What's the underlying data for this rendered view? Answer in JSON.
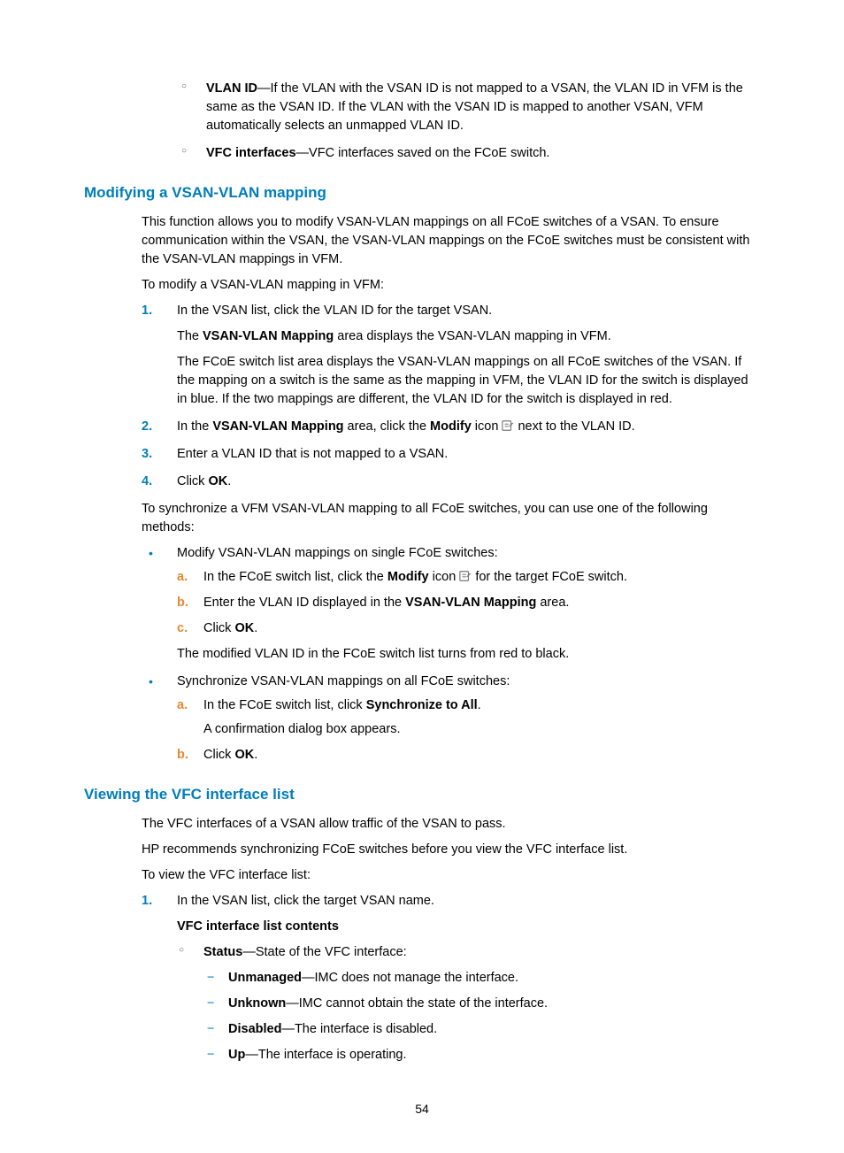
{
  "intro_bullets": {
    "vlan_id_term": "VLAN ID",
    "vlan_id_text": "—If the VLAN with the VSAN ID is not mapped to a VSAN, the VLAN ID in VFM is the same as the VSAN ID. If the VLAN with the VSAN ID is mapped to another VSAN, VFM automatically selects an unmapped VLAN ID.",
    "vfc_term": "VFC interfaces",
    "vfc_text": "—VFC interfaces saved on the FCoE switch."
  },
  "modifying": {
    "heading": "Modifying a VSAN-VLAN mapping",
    "p1": "This function allows you to modify VSAN-VLAN mappings on all FCoE switches of a VSAN. To ensure communication within the VSAN, the VSAN-VLAN mappings on the FCoE switches must be consistent with the VSAN-VLAN mappings in VFM.",
    "p2": "To modify a VSAN-VLAN mapping in VFM:",
    "steps": {
      "s1_m": "1.",
      "s1_t": "In the VSAN list, click the VLAN ID for the target VSAN.",
      "s1_a_pre": "The ",
      "s1_a_b": "VSAN-VLAN Mapping",
      "s1_a_post": " area displays the VSAN-VLAN mapping in VFM.",
      "s1_b": "The FCoE switch list area displays the VSAN-VLAN mappings on all FCoE switches of the VSAN. If the mapping on a switch is the same as the mapping in VFM, the VLAN ID for the switch is displayed in blue. If the two mappings are different, the VLAN ID for the switch is displayed in red.",
      "s2_m": "2.",
      "s2_pre": "In the ",
      "s2_b1": "VSAN-VLAN Mapping",
      "s2_mid": " area, click the ",
      "s2_b2": "Modify",
      "s2_mid2": " icon ",
      "s2_post": " next to the VLAN ID.",
      "s3_m": "3.",
      "s3_t": "Enter a VLAN ID that is not mapped to a VSAN.",
      "s4_m": "4.",
      "s4_pre": "Click ",
      "s4_b": "OK",
      "s4_post": "."
    },
    "p3": "To synchronize a VFM VSAN-VLAN mapping to all FCoE switches, you can use one of the following methods:",
    "method1": {
      "lead": "Modify VSAN-VLAN mappings on single FCoE switches:",
      "a_m": "a.",
      "a_pre": "In the FCoE switch list, click the ",
      "a_b": "Modify",
      "a_mid": " icon ",
      "a_post": " for the target FCoE switch.",
      "b_m": "b.",
      "b_pre": "Enter the VLAN ID displayed in the ",
      "b_b": "VSAN-VLAN Mapping",
      "b_post": " area.",
      "c_m": "c.",
      "c_pre": "Click ",
      "c_b": "OK",
      "c_post": ".",
      "foot": "The modified VLAN ID in the FCoE switch list turns from red to black."
    },
    "method2": {
      "lead": "Synchronize VSAN-VLAN mappings on all FCoE switches:",
      "a_m": "a.",
      "a_pre": "In the FCoE switch list, click ",
      "a_b": "Synchronize to All",
      "a_post": ".",
      "a_foot": "A confirmation dialog box appears.",
      "b_m": "b.",
      "b_pre": "Click ",
      "b_b": "OK",
      "b_post": "."
    }
  },
  "viewing": {
    "heading": "Viewing the VFC interface list",
    "p1": "The VFC interfaces of a VSAN allow traffic of the VSAN to pass.",
    "p2": "HP recommends synchronizing FCoE switches before you view the VFC interface list.",
    "p3": "To view the VFC interface list:",
    "s1_m": "1.",
    "s1_t": "In the VSAN list, click the target VSAN name.",
    "contents_head": "VFC interface list contents",
    "status_term": "Status",
    "status_text": "—State of the VFC interface:",
    "states": {
      "unmanaged_b": "Unmanaged",
      "unmanaged_t": "—IMC does not manage the interface.",
      "unknown_b": "Unknown",
      "unknown_t": "—IMC cannot obtain the state of the interface.",
      "disabled_b": "Disabled",
      "disabled_t": "—The interface is disabled.",
      "up_b": "Up",
      "up_t": "—The interface is operating."
    }
  },
  "page_number": "54"
}
